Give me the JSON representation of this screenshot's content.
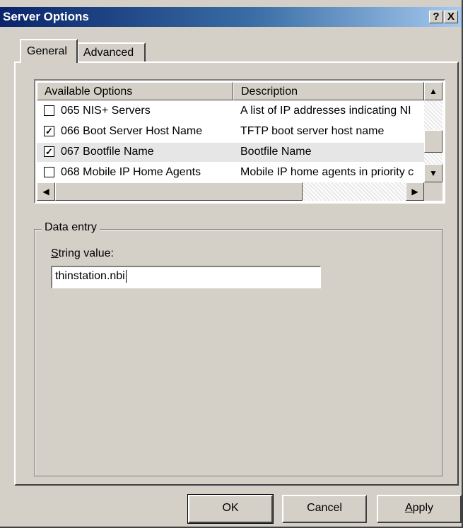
{
  "window": {
    "title": "Server Options",
    "help_label": "?",
    "close_label": "X"
  },
  "tabs": [
    {
      "label": "General",
      "selected": true
    },
    {
      "label": "Advanced",
      "selected": false
    }
  ],
  "list": {
    "columns": [
      "Available Options",
      "Description"
    ],
    "rows": [
      {
        "checked": false,
        "name": "065 NIS+ Servers",
        "description": "A list of IP addresses indicating NI"
      },
      {
        "checked": true,
        "name": "066 Boot Server Host Name",
        "description": "TFTP boot server host name"
      },
      {
        "checked": true,
        "name": "067 Bootfile Name",
        "description": "Bootfile Name",
        "selected": true
      },
      {
        "checked": false,
        "name": "068 Mobile IP Home Agents",
        "description": "Mobile IP home agents in priority c"
      }
    ]
  },
  "data_entry": {
    "group_label": "Data entry",
    "field_label_accel": "S",
    "field_label_rest": "tring value:",
    "value": "thinstation.nbi"
  },
  "buttons": {
    "ok": "OK",
    "cancel": "Cancel",
    "apply_accel": "A",
    "apply_rest": "pply"
  },
  "colors": {
    "titlebar": "#0a246a",
    "face": "#d4d0c8"
  }
}
